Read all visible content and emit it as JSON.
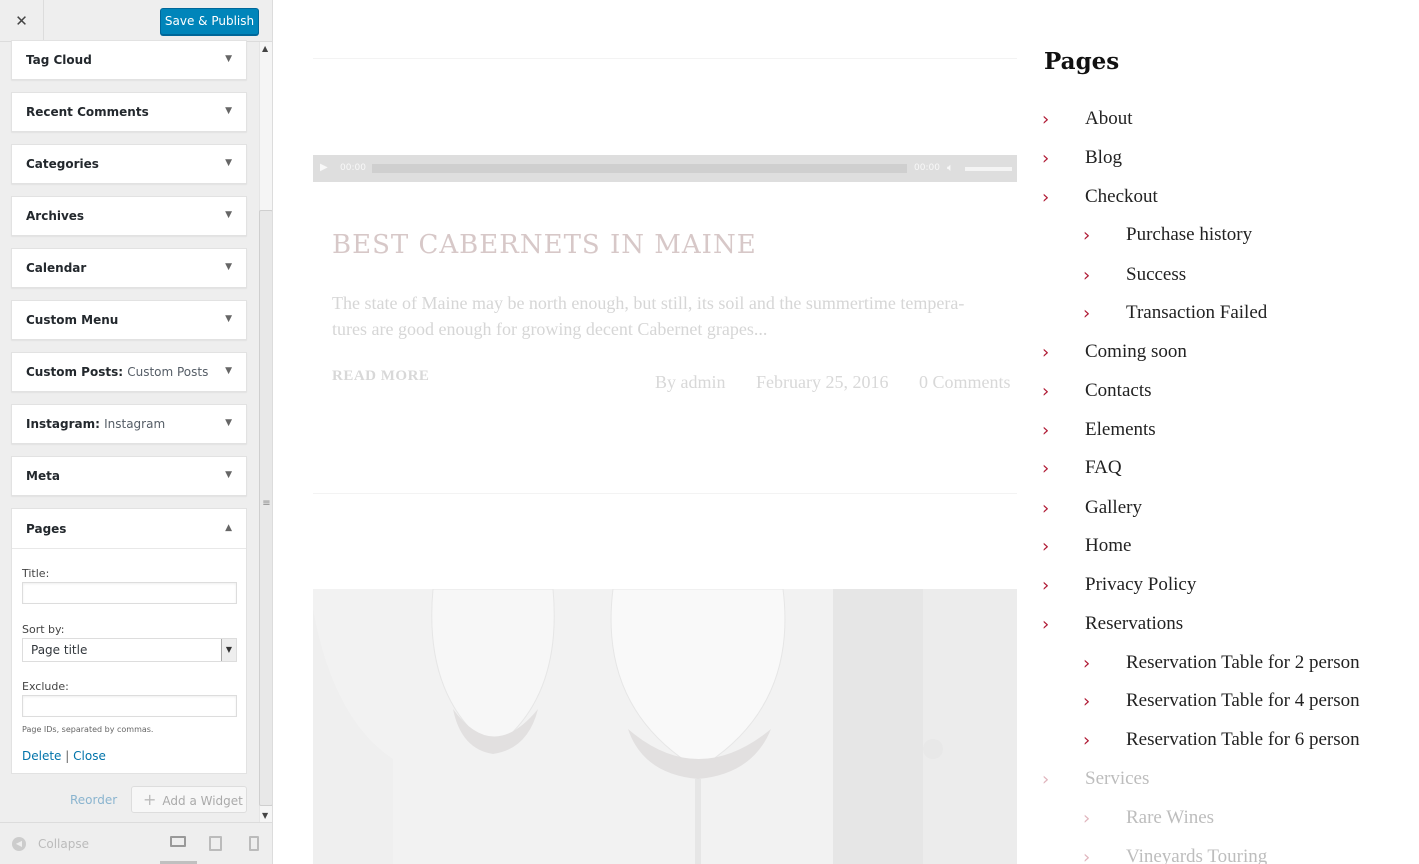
{
  "customizer": {
    "close_icon": "close-icon",
    "save_label": "Save & Publish",
    "widgets": [
      {
        "label": "Tag Cloud",
        "sub": ""
      },
      {
        "label": "Recent Comments",
        "sub": ""
      },
      {
        "label": "Categories",
        "sub": ""
      },
      {
        "label": "Archives",
        "sub": ""
      },
      {
        "label": "Calendar",
        "sub": ""
      },
      {
        "label": "Custom Menu",
        "sub": ""
      },
      {
        "label": "Custom Posts:",
        "sub": "Custom Posts"
      },
      {
        "label": "Instagram:",
        "sub": "Instagram"
      },
      {
        "label": "Meta",
        "sub": ""
      }
    ],
    "pages_widget": {
      "label": "Pages",
      "title_label": "Title:",
      "title_value": "",
      "sort_label": "Sort by:",
      "sort_value": "Page title",
      "exclude_label": "Exclude:",
      "exclude_value": "",
      "hint": "Page IDs, separated by commas.",
      "delete_label": "Delete",
      "separator": "|",
      "close_label": "Close"
    },
    "reorder_label": "Reorder",
    "add_widget_label": "Add a Widget",
    "collapse_label": "Collapse",
    "accent_color": "#0085ba"
  },
  "preview": {
    "audio": {
      "time_start": "00:00",
      "time_end": "00:00"
    },
    "post": {
      "title": "BEST CABERNETS IN MAINE",
      "excerpt": "The state of Maine may be north enough, but still, its soil and the summertime tempera-tures are good enough for growing decent Cabernet grapes...",
      "read_more": "READ MORE",
      "author": "By admin",
      "date": "February 25, 2016",
      "comments": "0 Comments"
    },
    "pages_title": "Pages",
    "pages": [
      {
        "label": "About"
      },
      {
        "label": "Blog"
      },
      {
        "label": "Checkout"
      },
      {
        "label": "Purchase history"
      },
      {
        "label": "Success"
      },
      {
        "label": "Transaction Failed"
      },
      {
        "label": "Coming soon"
      },
      {
        "label": "Contacts"
      },
      {
        "label": "Elements"
      },
      {
        "label": "FAQ"
      },
      {
        "label": "Gallery"
      },
      {
        "label": "Home"
      },
      {
        "label": "Privacy Policy"
      },
      {
        "label": "Reservations"
      },
      {
        "label": "Reservation Table for 2 person"
      },
      {
        "label": "Reservation Table for 4 person"
      },
      {
        "label": "Reservation Table for 6 person"
      },
      {
        "label": "Services"
      },
      {
        "label": "Rare Wines"
      },
      {
        "label": "Vineyards Touring"
      }
    ],
    "chevron_color": "#b01b35"
  }
}
